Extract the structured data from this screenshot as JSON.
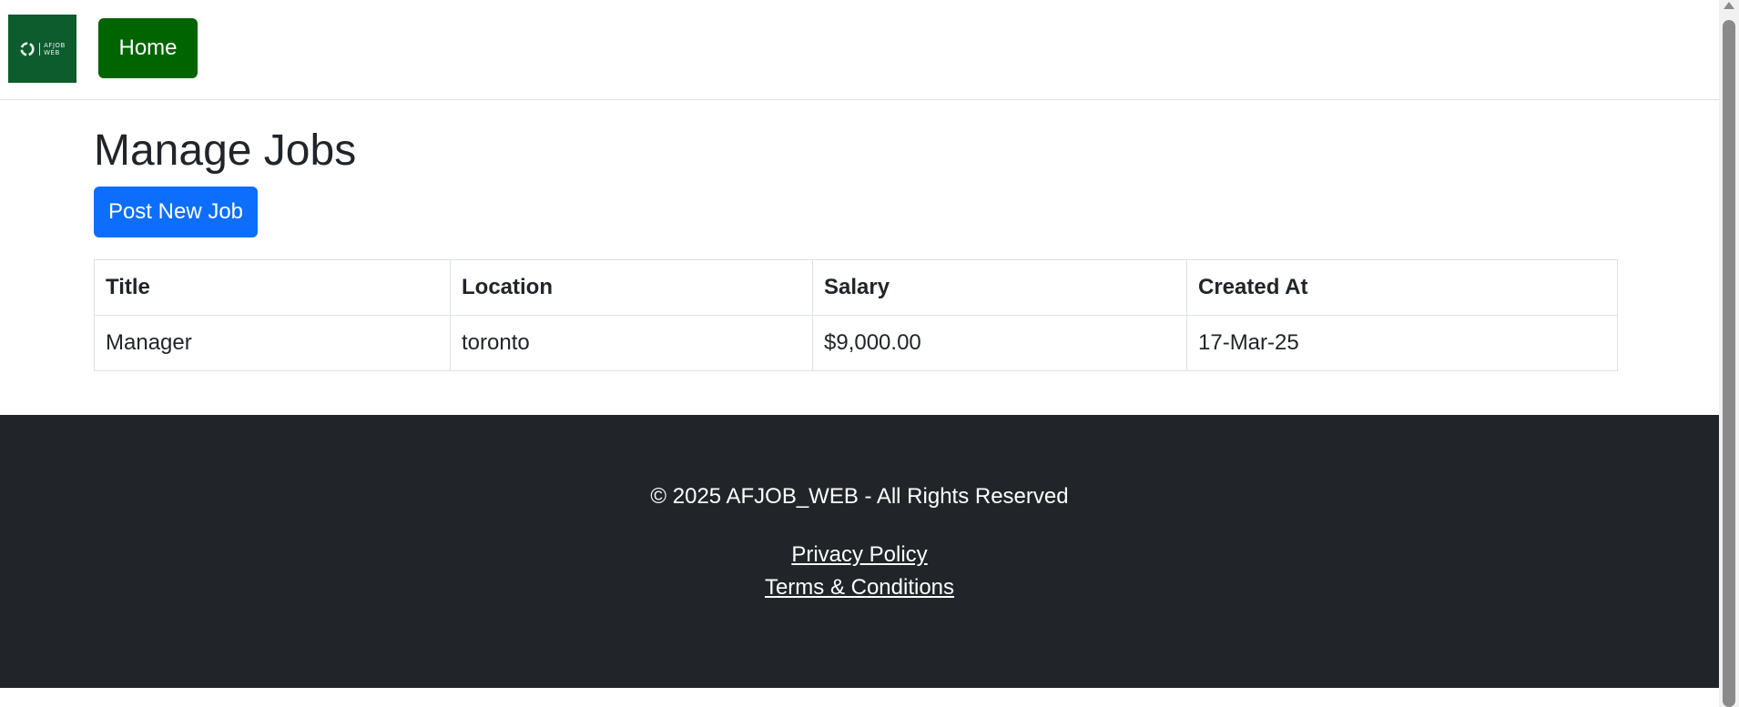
{
  "navbar": {
    "logo_text_line1": "AFJOB",
    "logo_text_line2": "WEB",
    "home_label": "Home"
  },
  "main": {
    "title": "Manage Jobs",
    "post_button_label": "Post New Job",
    "table": {
      "headers": [
        "Title",
        "Location",
        "Salary",
        "Created At"
      ],
      "rows": [
        [
          "Manager",
          "toronto",
          "$9,000.00",
          "17-Mar-25"
        ]
      ]
    }
  },
  "footer": {
    "copyright": "© 2025 AFJOB_WEB - All Rights Reserved",
    "links": [
      "Privacy Policy",
      "Terms & Conditions"
    ]
  },
  "colors": {
    "home_button": "#006400",
    "primary_button": "#0d6efd",
    "footer_bg": "#212529",
    "logo_bg": "#0d5c2e"
  }
}
